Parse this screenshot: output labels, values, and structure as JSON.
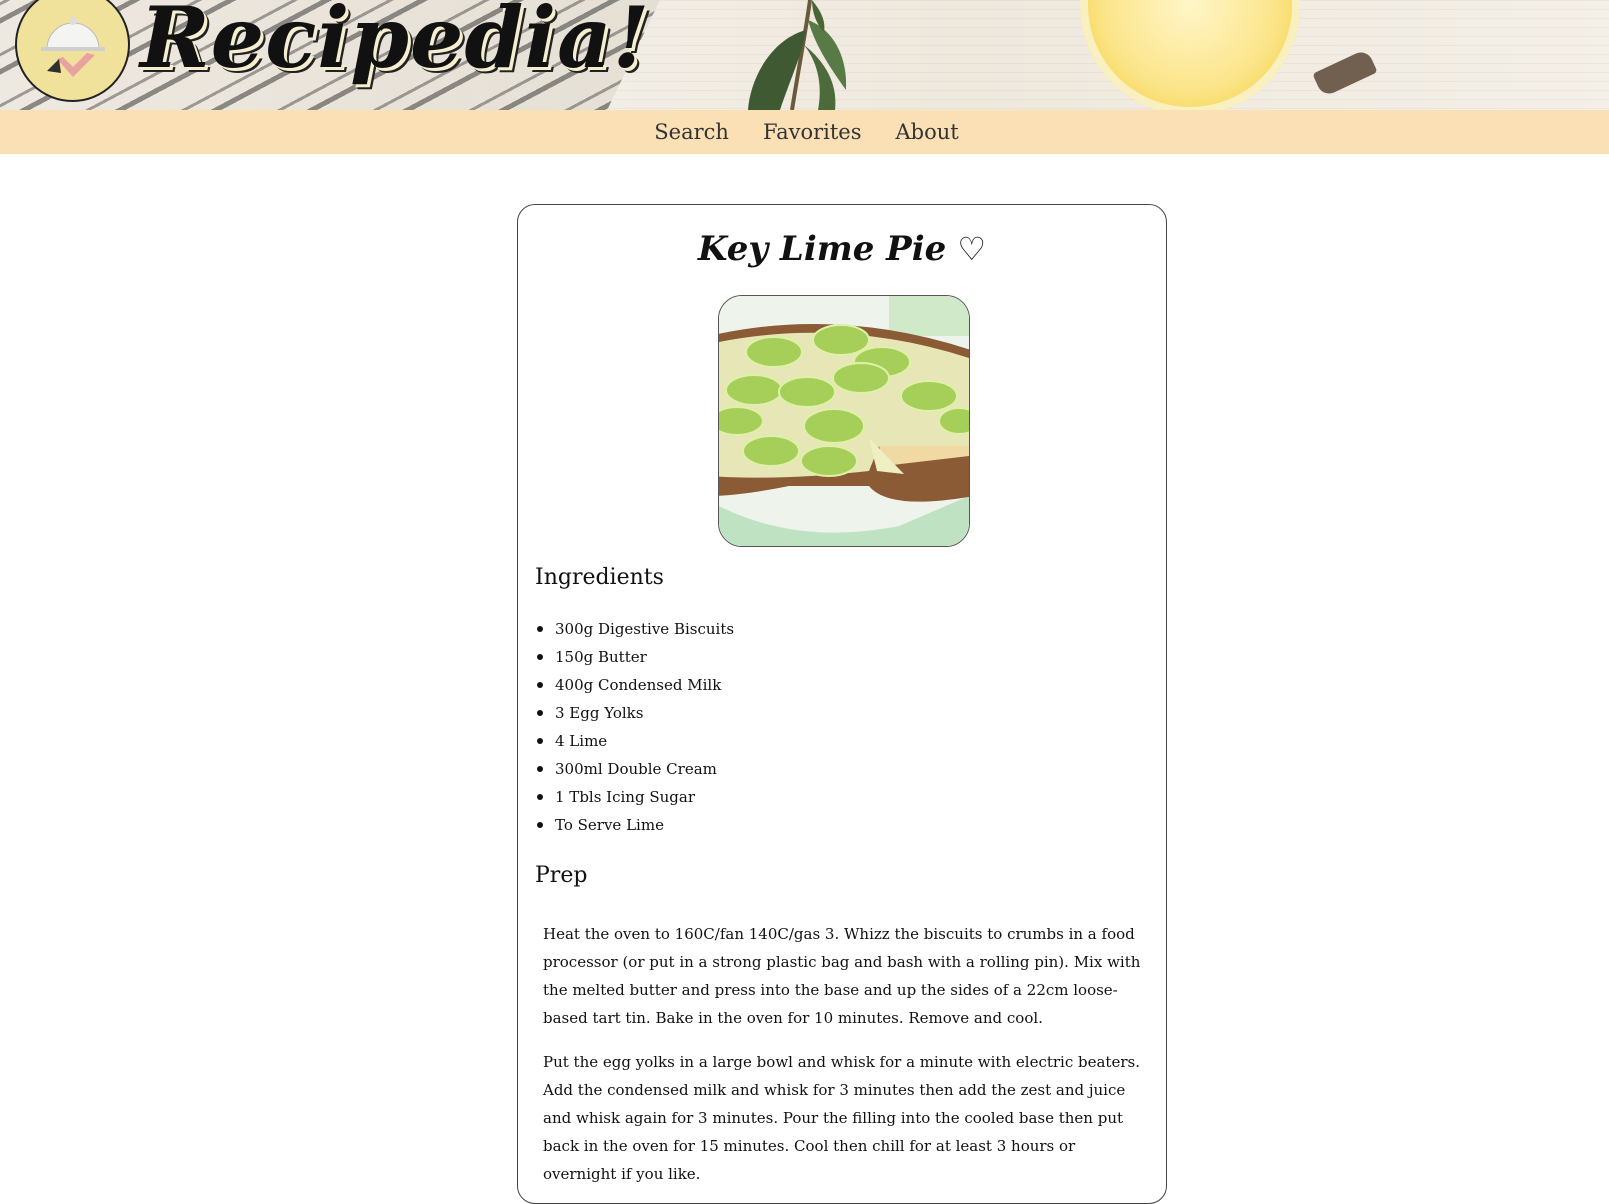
{
  "header": {
    "brand_name": "Recipedia!",
    "logo_icon": "cloche-icon"
  },
  "nav": {
    "items": [
      {
        "label": "Search"
      },
      {
        "label": "Favorites"
      },
      {
        "label": "About"
      }
    ]
  },
  "recipe": {
    "title": "Key Lime Pie",
    "favorite_icon": "heart-outline-icon",
    "favorite_glyph": "♡",
    "image_alt_subject": "key-lime-pie-photo",
    "ingredients_heading": "Ingredients",
    "ingredients": [
      "300g Digestive Biscuits",
      "150g Butter",
      "400g Condensed Milk",
      "3 Egg Yolks",
      "4 Lime",
      "300ml Double Cream",
      "1 Tbls Icing Sugar",
      "To Serve Lime"
    ],
    "prep_heading": "Prep",
    "prep_steps": [
      "Heat the oven to 160C/fan 140C/gas 3. Whizz the biscuits to crumbs in a food processor (or put in a strong plastic bag and bash with a rolling pin). Mix with the melted butter and press into the base and up the sides of a 22cm loose-based tart tin. Bake in the oven for 10 minutes. Remove and cool.",
      "Put the egg yolks in a large bowl and whisk for a minute with electric beaters. Add the condensed milk and whisk for 3 minutes then add the zest and juice and whisk again for 3 minutes. Pour the filling into the cooled base then put back in the oven for 15 minutes. Cool then chill for at least 3 hours or overnight if you like."
    ]
  },
  "colors": {
    "nav_background": "#fbe0b6",
    "logo_background": "#f0e29b",
    "text": "#111111"
  }
}
